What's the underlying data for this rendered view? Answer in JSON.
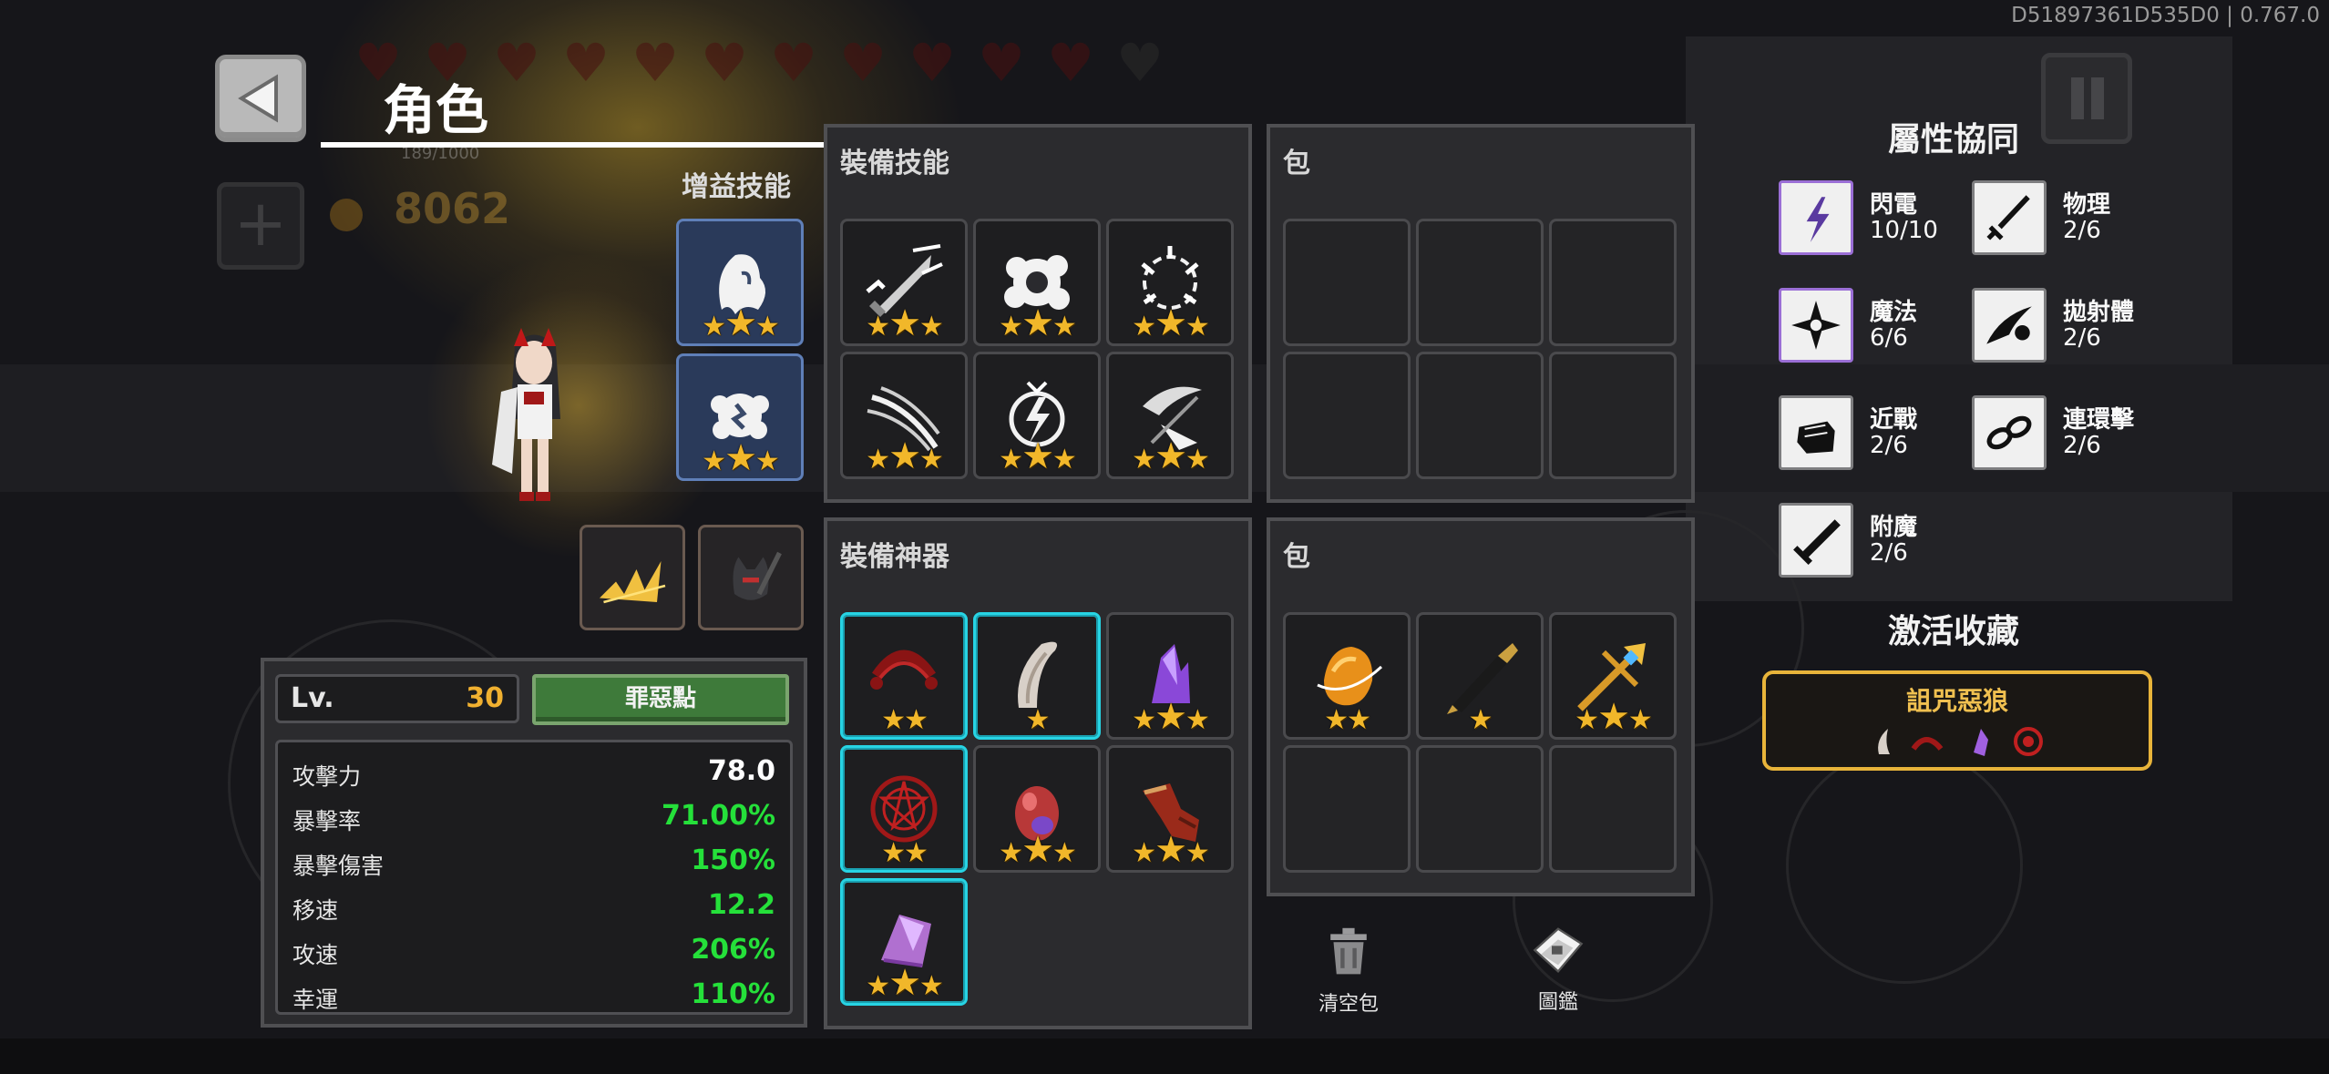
{
  "build_id": "D51897361D535D0 | 0.767.0",
  "header": {
    "title": "角色",
    "hp_text": "189/1000",
    "gold": "8062"
  },
  "buff_skills": {
    "title": "增益技能",
    "slots": [
      {
        "icon": "ghost-icon",
        "stars": 3
      },
      {
        "icon": "flower-orb-icon",
        "stars": 3
      }
    ]
  },
  "equip_skills": {
    "title": "裝備技能",
    "slots": [
      {
        "icon": "sword-slash-icon",
        "stars": 3
      },
      {
        "icon": "burst-icon",
        "stars": 3
      },
      {
        "icon": "shockwave-icon",
        "stars": 3
      },
      {
        "icon": "claw-slash-icon",
        "stars": 3
      },
      {
        "icon": "lightning-orb-icon",
        "stars": 3
      },
      {
        "icon": "whirl-blade-icon",
        "stars": 3
      }
    ]
  },
  "skill_bag": {
    "title": "包"
  },
  "equip_artifacts": {
    "title": "裝備神器",
    "slots": [
      {
        "icon": "red-bow-icon",
        "stars": 2
      },
      {
        "icon": "fang-icon",
        "stars": 1
      },
      {
        "icon": "purple-crystal-icon",
        "stars": 3
      },
      {
        "icon": "blood-sigil-icon",
        "stars": 2
      },
      {
        "icon": "red-egg-icon",
        "stars": 3
      },
      {
        "icon": "gauntlet-icon",
        "stars": 3
      },
      {
        "icon": "amethyst-icon",
        "stars": 3
      }
    ]
  },
  "artifact_bag": {
    "title": "包",
    "slots": [
      {
        "icon": "amber-ring-icon",
        "stars": 2
      },
      {
        "icon": "pen-icon",
        "stars": 1
      },
      {
        "icon": "golden-trident-icon",
        "stars": 3
      }
    ]
  },
  "character": {
    "level_label": "Lv.",
    "level": "30",
    "sin_button": "罪惡點",
    "stats": [
      {
        "label": "攻擊力",
        "value": "78.0",
        "color": "#ffffff"
      },
      {
        "label": "暴擊率",
        "value": "71.00%",
        "color": "#25e03a"
      },
      {
        "label": "暴擊傷害",
        "value": "150%",
        "color": "#25e03a"
      },
      {
        "label": "移速",
        "value": "12.2",
        "color": "#25e03a"
      },
      {
        "label": "攻速",
        "value": "206%",
        "color": "#25e03a"
      },
      {
        "label": "幸運",
        "value": "110%",
        "color": "#25e03a"
      }
    ]
  },
  "synergy": {
    "title": "屬性協同",
    "items": [
      {
        "name": "閃電",
        "value": "10/10",
        "icon": "lightning-icon"
      },
      {
        "name": "物理",
        "value": "2/6",
        "icon": "sword-icon"
      },
      {
        "name": "魔法",
        "value": "6/6",
        "icon": "magic-star-icon"
      },
      {
        "name": "拋射體",
        "value": "2/6",
        "icon": "projectile-icon"
      },
      {
        "name": "近戰",
        "value": "2/6",
        "icon": "fist-icon"
      },
      {
        "name": "連環擊",
        "value": "2/6",
        "icon": "chain-icon"
      },
      {
        "name": "附魔",
        "value": "2/6",
        "icon": "enchant-sword-icon"
      }
    ]
  },
  "collection": {
    "title": "激活收藏",
    "set_name": "詛咒惡狼"
  },
  "actions": {
    "clear_bag": "清空包",
    "codex": "圖鑑"
  },
  "colors": {
    "accent_gold": "#e8b43a",
    "stat_green": "#25e03a",
    "artifact_border": "#27d4e4"
  }
}
